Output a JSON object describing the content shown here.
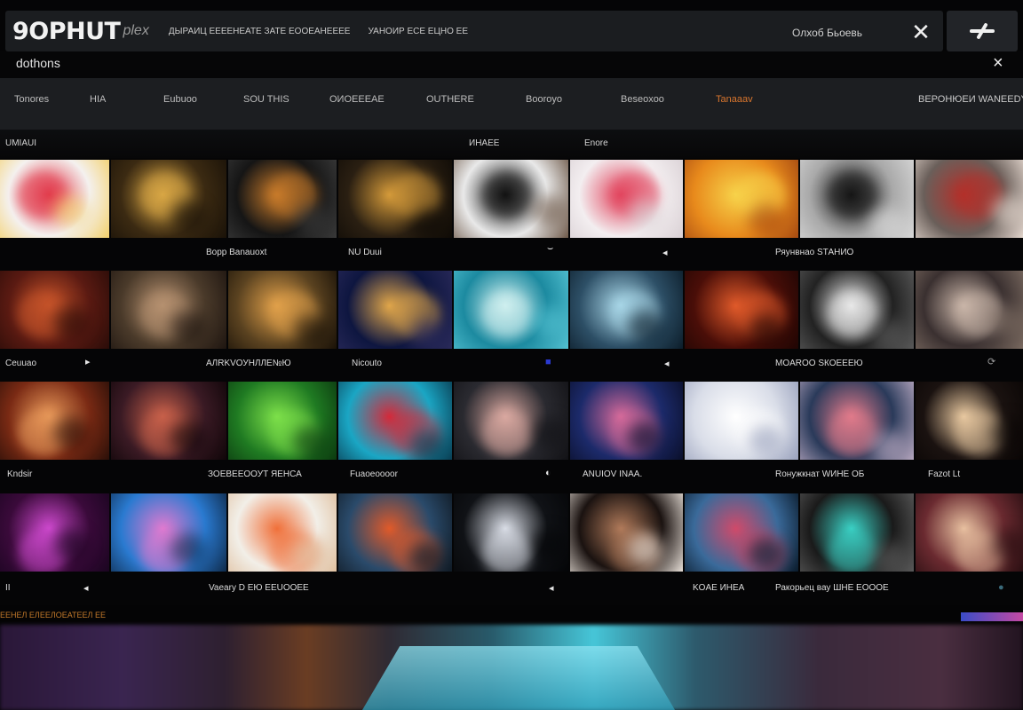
{
  "header": {
    "logo": "9OPHUT",
    "logo_sub": "plex",
    "link_1": "ДЫРАИЦ ЕЕЕЕНЕАТЕ ЗАТЕ ЕООЕАНЕЕЕЕ",
    "link_2": "УАНОИР ЕСЕ ЕЦНО ЕЕ",
    "right_text": "Олхоб Бьоевь"
  },
  "search": {
    "value": "dothons"
  },
  "categories": [
    "Tonores",
    "HIA",
    "Eubuoo",
    "SOU THIS",
    "ОИОЕЕЕАЕ",
    "OUTHERE",
    "Booroyo",
    "Beseoxoo",
    "Tanaaav"
  ],
  "category_right": "ВЕРОНЮЕИ WANEEDY",
  "section": {
    "left": "UMIAUI",
    "middle": "ИНАЕЕ",
    "right": "Enore"
  },
  "rows": [
    {
      "tiles": [
        {
          "c1": "#f4f1ef",
          "c2": "#e23a4c",
          "c3": "#f3d06a"
        },
        {
          "c1": "#3b2a12",
          "c2": "#d9a745",
          "c3": "#1a1208"
        },
        {
          "c1": "#151515",
          "c2": "#c77a2a",
          "c3": "#3a3a3a"
        },
        {
          "c1": "#2a1f12",
          "c2": "#d49a3a",
          "c3": "#0f0b06"
        },
        {
          "c1": "#e9e9e9",
          "c2": "#121212",
          "c3": "#6f5a4a"
        },
        {
          "c1": "#f3eef0",
          "c2": "#e2465f",
          "c3": "#d9d0d4"
        },
        {
          "c1": "#e88a1c",
          "c2": "#f7d24a",
          "c3": "#a64a12"
        },
        {
          "c1": "#a9a9a9",
          "c2": "#161616",
          "c3": "#d8d8d8"
        },
        {
          "c1": "#6a5f5a",
          "c2": "#b3302a",
          "c3": "#e3d6cd"
        }
      ]
    },
    {
      "tiles": [
        {
          "c1": "#5a1a12",
          "c2": "#c7542a",
          "c3": "#2a0c08"
        },
        {
          "c1": "#4a3a2a",
          "c2": "#b69170",
          "c3": "#1e1510"
        },
        {
          "c1": "#5a4220",
          "c2": "#e0a04a",
          "c3": "#1a1208"
        },
        {
          "c1": "#0e1640",
          "c2": "#e0a64a",
          "c3": "#2a2a5a"
        },
        {
          "c1": "#1c8aa0",
          "c2": "#cfefef",
          "c3": "#54c2d2"
        },
        {
          "c1": "#2d4f66",
          "c2": "#a7d5e6",
          "c3": "#0c1d2a"
        },
        {
          "c1": "#4a0e08",
          "c2": "#e05a2a",
          "c3": "#1f0604"
        },
        {
          "c1": "#222",
          "c2": "#e8e8e8",
          "c3": "#5a5a5a"
        },
        {
          "c1": "#3a3030",
          "c2": "#c9b5a8",
          "c3": "#7a6a60"
        }
      ]
    },
    {
      "tiles": [
        {
          "c1": "#7a2a14",
          "c2": "#e9995a",
          "c3": "#2a0f08"
        },
        {
          "c1": "#3a1a24",
          "c2": "#c7604a",
          "c3": "#0f0508"
        },
        {
          "c1": "#1f7a22",
          "c2": "#7de04a",
          "c3": "#0c3a10"
        },
        {
          "c1": "#1aa6c4",
          "c2": "#d42a3a",
          "c3": "#0a3d52"
        },
        {
          "c1": "#2a2a30",
          "c2": "#d9a8a0",
          "c3": "#121216"
        },
        {
          "c1": "#1c2a6a",
          "c2": "#d56a9a",
          "c3": "#0a0f2a"
        },
        {
          "c1": "#d9dde8",
          "c2": "#ffffff",
          "c3": "#9aa2bd"
        },
        {
          "c1": "#2a3a5a",
          "c2": "#e07a8a",
          "c3": "#b8a8c0"
        },
        {
          "c1": "#1a1210",
          "c2": "#e8c8a0",
          "c3": "#0a0605"
        }
      ]
    },
    {
      "tiles": [
        {
          "c1": "#3a0a3a",
          "c2": "#d04ad0",
          "c3": "#1a0520"
        },
        {
          "c1": "#2a7ad0",
          "c2": "#e07ad0",
          "c3": "#0f2a4a"
        },
        {
          "c1": "#f2efe8",
          "c2": "#f0703a",
          "c3": "#e0c0a0"
        },
        {
          "c1": "#2a4a6a",
          "c2": "#e05a2a",
          "c3": "#101a24"
        },
        {
          "c1": "#101216",
          "c2": "#d9dde6",
          "c3": "#050608"
        },
        {
          "c1": "#1a1210",
          "c2": "#b07a5a",
          "c3": "#e8e0d8"
        },
        {
          "c1": "#3a6a9a",
          "c2": "#d04a6a",
          "c3": "#0a1a2a"
        },
        {
          "c1": "#1a1a1a",
          "c2": "#3ad0c4",
          "c3": "#5a5a5a"
        },
        {
          "c1": "#6a2a30",
          "c2": "#e8c0a0",
          "c3": "#2a0f12"
        }
      ]
    }
  ],
  "captions": [
    {
      "items": [
        "Ворр Banauoxt",
        "NU Duui",
        "Ряунвнао SТАНИО"
      ]
    },
    {
      "items": [
        "Ceuuao",
        "AЛRKVОУНЛЛЕ№Ю",
        "Nicouto",
        "MOAROO SКОЕЕЕЮ"
      ]
    },
    {
      "items": [
        "Kndsir",
        "ЗОЕВЕЕООУТ ЯЕНСА",
        "Fuaoeoooor",
        "ANUIOV INAA.",
        "Rонужкнат WИНЕ ОБ",
        "Fazot Lt"
      ]
    },
    {
      "items": [
        "II",
        "Vaeary D ЕЮ ЕЕUOOEE",
        "KOАЕ ИНЕА",
        "Ракорьец вау ШНЕ ЕОООЕ"
      ]
    }
  ],
  "bottom": {
    "left_text": "ЕЕНЕЛ ЕЛЕЕЛОЕАТЕЕЛ ЕЕ"
  },
  "colors": {
    "accent": "#d9762e",
    "background": "#050506",
    "bar": "#1c1e21"
  }
}
